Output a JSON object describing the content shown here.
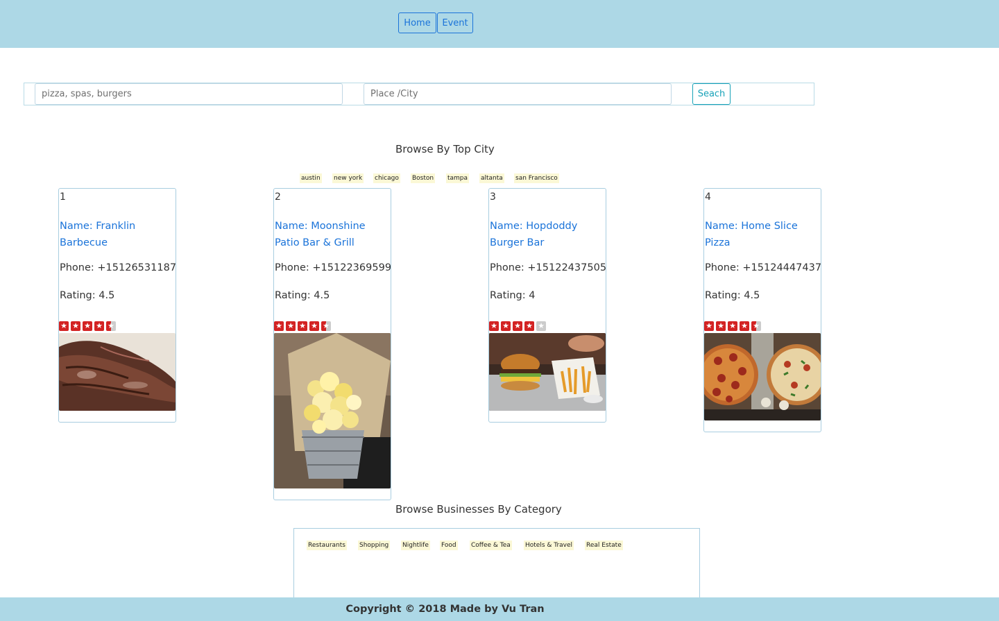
{
  "nav": {
    "home_label": "Home",
    "event_label": "Event"
  },
  "search": {
    "term_placeholder": "pizza, spas, burgers",
    "place_placeholder": "Place /City",
    "button_label": "Seach"
  },
  "top_city": {
    "title": "Browse By Top City",
    "cities": [
      "austin",
      "new york",
      "chicago",
      "Boston",
      "tampa",
      "altanta",
      "san Francisco"
    ]
  },
  "businesses": [
    {
      "number": "1",
      "name": "Name: Franklin Barbecue",
      "phone": "Phone: +15126531187",
      "rating": "Rating: 4.5",
      "stars": 4.5,
      "photo": "brisket-photo"
    },
    {
      "number": "2",
      "name": "Name: Moonshine Patio Bar & Grill",
      "phone": "Phone: +15122369599",
      "rating": "Rating: 4.5",
      "stars": 4.5,
      "photo": "popcorn-photo"
    },
    {
      "number": "3",
      "name": "Name: Hopdoddy Burger Bar",
      "phone": "Phone: +15122437505",
      "rating": "Rating: 4",
      "stars": 4,
      "photo": "burger-photo"
    },
    {
      "number": "4",
      "name": "Name: Home Slice Pizza",
      "phone": "Phone: +15124447437",
      "rating": "Rating: 4.5",
      "stars": 4.5,
      "photo": "pizza-photo"
    }
  ],
  "category": {
    "title": "Browse Businesses By Category",
    "items": [
      "Restaurants",
      "Shopping",
      "Nightlife",
      "Food",
      "Coffee & Tea",
      "Hotels & Travel",
      "Real Estate"
    ]
  },
  "footer": {
    "copyright": "Copyright © 2018 Made by Vu Tran"
  },
  "colors": {
    "header_bg": "#add8e6",
    "link": "#1a73d9",
    "star_on": "#d32323",
    "star_off": "#cccccc",
    "tag_bg": "#fbf8d6"
  }
}
